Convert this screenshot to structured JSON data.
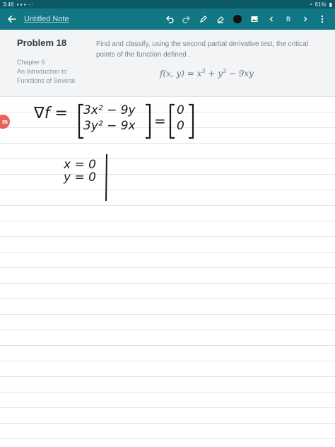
{
  "status_bar": {
    "time": "3:46",
    "battery": "61%"
  },
  "toolbar": {
    "note_title": "Untitled Note",
    "page_label": "B"
  },
  "problem": {
    "title": "Problem 18",
    "chapter_lines": [
      "Chapter 6",
      "An Introduction to",
      "Functions of Several"
    ],
    "text": "Find and classify, using the second partial derivative test, the critical points of the function defined .",
    "formula_lhs": "f(x, y) = x",
    "formula_mid": " + y",
    "formula_rhs": " − 9xy",
    "formula_exp": "3"
  },
  "handwriting": {
    "gradient_lhs": "∇f =",
    "row1": "3x² − 9y",
    "row2": "3y² − 9x",
    "equals": "=",
    "zero1": "0",
    "zero2": "0",
    "cond1": "x = 0",
    "cond2": "y = 0"
  },
  "side_badge": "m",
  "colors": {
    "toolbar": "#117784",
    "status_bar": "#0b5a66",
    "header_bg": "#f3f4f5",
    "line": "#d9e7f1",
    "badge": "#e8615a"
  }
}
